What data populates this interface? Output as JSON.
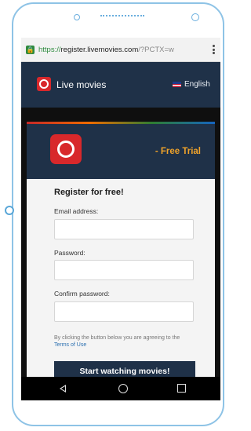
{
  "browser": {
    "url_scheme": "https://",
    "url_host": "register.livemovies.com",
    "url_path": "/?PCTX=w"
  },
  "app": {
    "brand": "Live movies",
    "language": "English"
  },
  "card": {
    "badge": "- Free Trial",
    "title": "Register for free!",
    "email_label": "Email address:",
    "password_label": "Password:",
    "confirm_label": "Confirm password:",
    "email_value": "",
    "password_value": "",
    "confirm_value": "",
    "agreement": "By clicking the button below you are agreeing to the",
    "terms_link": "Terms of Use",
    "cta": "Start watching movies!"
  },
  "colors": {
    "header_navy": "#1f3148",
    "logo_red": "#d8282b",
    "trial_orange": "#f0a32a",
    "link_blue": "#2a6fb0",
    "phone_outline": "#8ec3e6"
  },
  "icons": [
    "lock-icon",
    "more-vert-icon",
    "film-reel-icon",
    "us-flag-icon",
    "nav-back-icon",
    "nav-home-icon",
    "nav-recents-icon"
  ]
}
